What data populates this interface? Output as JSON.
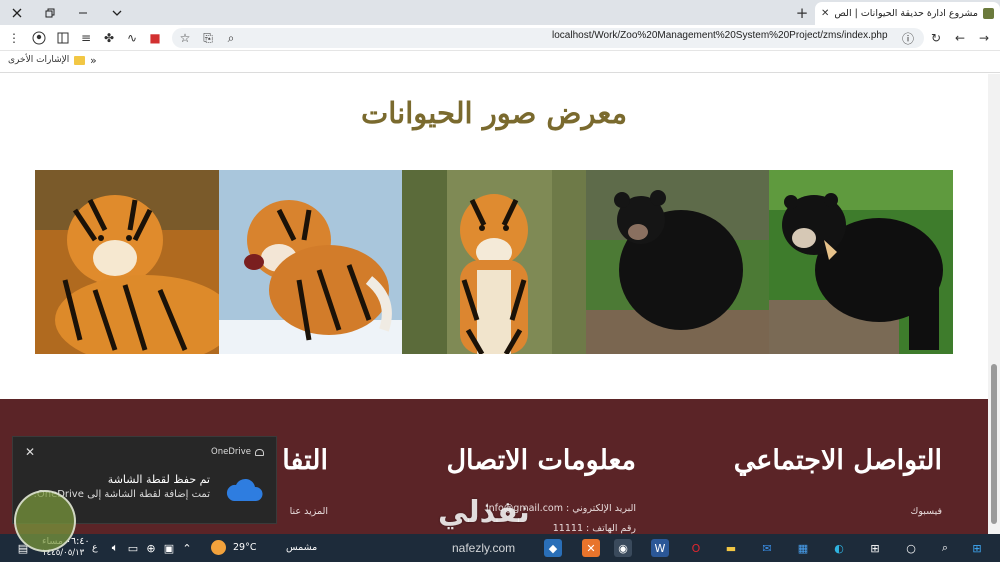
{
  "browser": {
    "tab_title": "مشروع ادارة حديقة الحيوانات | الص",
    "url": "localhost/Work/Zoo%20Management%20System%20Project/zms/index.php",
    "bookmarks_label": "الإشارات الأخرى",
    "bookmarks_more": "»"
  },
  "page": {
    "gallery_title": "معرض صور الحيوانات",
    "photos": [
      {
        "alt": "tiger-lying",
        "kind": "tiger"
      },
      {
        "alt": "tiger-snarling",
        "kind": "tiger"
      },
      {
        "alt": "tiger-standing",
        "kind": "tiger"
      },
      {
        "alt": "black-bear",
        "kind": "bear"
      },
      {
        "alt": "sun-bear",
        "kind": "bear"
      }
    ],
    "footer": {
      "social_title": "التواصل الاجتماعي",
      "social_link": "فيسبوك",
      "contact_title": "معلومات الاتصال",
      "contact_email": "البريد الإلكتروني : info@gmail.com",
      "contact_phone": "رقم الهاتف : 11111",
      "third_title": "التفا",
      "third_link": "المزيد عنا"
    }
  },
  "toast": {
    "app_name": "OneDrive",
    "title": "تم حفظ لقطة الشاشة",
    "body": "تمت إضافة لقطة الشاشة إلى OneDrive."
  },
  "taskbar": {
    "time": "٠٦:٤٠ مساء",
    "date": "١٤٤٥/٠٥/١٣",
    "lang": "ع",
    "temperature": "29°C",
    "weather": "مشمس"
  },
  "watermark": {
    "text": "نفذلي",
    "url": "nafezly.com"
  },
  "colors": {
    "footer_bg": "#5b2427",
    "title_color": "#7a6a2e",
    "taskbar_bg": "#1d2b3a"
  }
}
